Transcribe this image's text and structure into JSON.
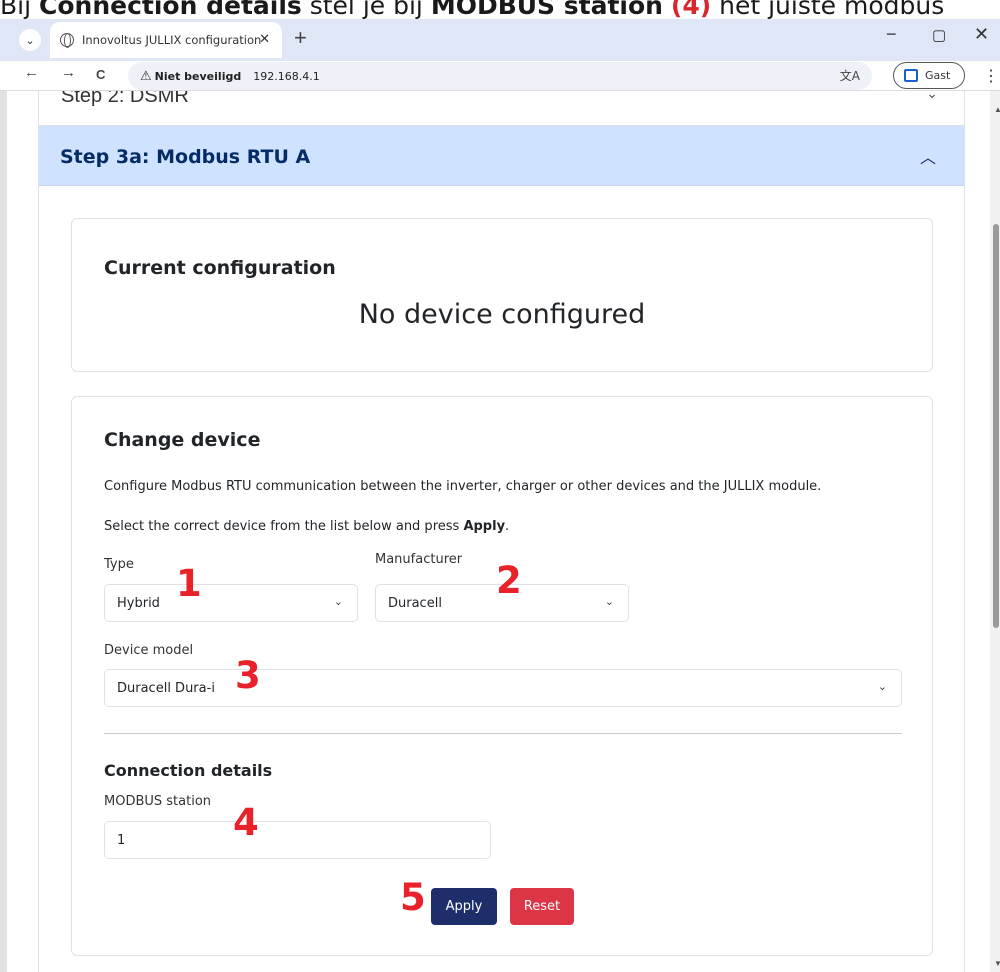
{
  "caption": {
    "prefix": "Bij ",
    "connection_details": "Connection details",
    "mid": " stel je bij ",
    "modbus_station": "MODBUS station",
    "number_ref": "(4)",
    "suffix": " het juiste modbus"
  },
  "browser": {
    "tab_title": "Innovoltus JULLIX configuration",
    "tab_close": "✕",
    "new_tab": "+",
    "minimize": "−",
    "maximize": "▢",
    "close": "✕",
    "back": "←",
    "forward": "→",
    "reload": "C",
    "insecure_label": "Niet beveiligd",
    "url": "192.168.4.1",
    "profile_label": "Gast",
    "menu": "⋮"
  },
  "accordion": {
    "step2_title": "Step 2: DSMR",
    "step3a_title": "Step 3a: Modbus RTU A"
  },
  "current": {
    "heading": "Current configuration",
    "status": "No device configured"
  },
  "change": {
    "heading": "Change device",
    "description": "Configure Modbus RTU communication between the inverter, charger or other devices and the JULLIX module.",
    "instruction_prefix": "Select the correct device from the list below and press ",
    "instruction_bold": "Apply",
    "instruction_suffix": ".",
    "type_label": "Type",
    "type_value": "Hybrid",
    "manufacturer_label": "Manufacturer",
    "manufacturer_value": "Duracell",
    "model_label": "Device model",
    "model_value": "Duracell Dura-i",
    "connection_heading": "Connection details",
    "station_label": "MODBUS station",
    "station_value": "1",
    "apply_label": "Apply",
    "reset_label": "Reset"
  },
  "annotations": [
    "1",
    "2",
    "3",
    "4",
    "5"
  ],
  "colors": {
    "accordion_active_bg": "#cfe2ff",
    "accordion_active_text": "#052c65",
    "apply_button": "#1d2e6b",
    "reset_button": "#dc3545",
    "annotation_red": "#e8212a"
  },
  "icons": {
    "tab_favicon": "globe-icon",
    "insecure": "warning-triangle-icon",
    "translate": "translate-icon",
    "profile": "profile-icon",
    "select_arrow": "chevron-down-icon",
    "accordion_toggle": "chevron-up-icon"
  }
}
